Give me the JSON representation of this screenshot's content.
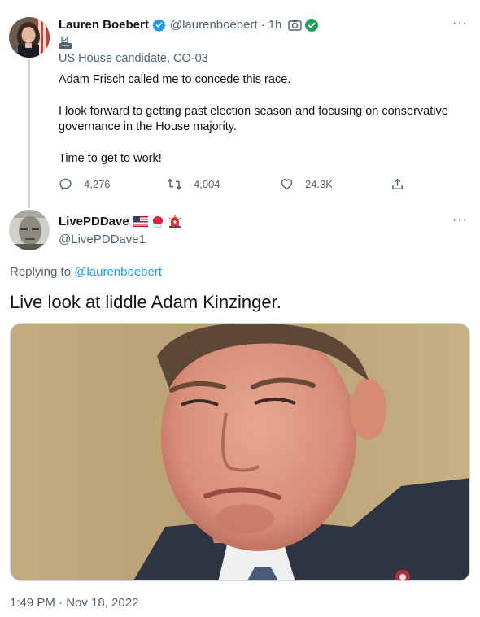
{
  "colors": {
    "text": "#0f1419",
    "secondary": "#536471",
    "accent": "#1d9bf0",
    "verified": "#1d9bf0",
    "thread_line": "#cfd9de"
  },
  "tweet1": {
    "display_name": "Lauren Boebert",
    "handle": "@laurenboebert",
    "separator": "·",
    "time": "1h",
    "badge_icon": "ballot-box-icon",
    "label": "US House candidate, CO-03",
    "paragraphs": [
      "Adam Frisch called me to concede this race.",
      "I look forward to getting past election season and focusing on conservative governance in the House majority.",
      "Time to get to work!"
    ],
    "stats": {
      "replies": "4,276",
      "retweets": "4,004",
      "likes": "24.3K"
    }
  },
  "tweet2": {
    "display_name": "LivePDDave",
    "name_emojis": [
      "us-flag-icon",
      "boxing-glove-icon",
      "police-light-icon"
    ],
    "handle": "@LivePDDave1",
    "replying_prefix": "Replying to",
    "replying_to": "@laurenboebert",
    "text": "Live look at liddle Adam Kinzinger.",
    "timestamp": "1:49 PM · Nov 18, 2022"
  }
}
